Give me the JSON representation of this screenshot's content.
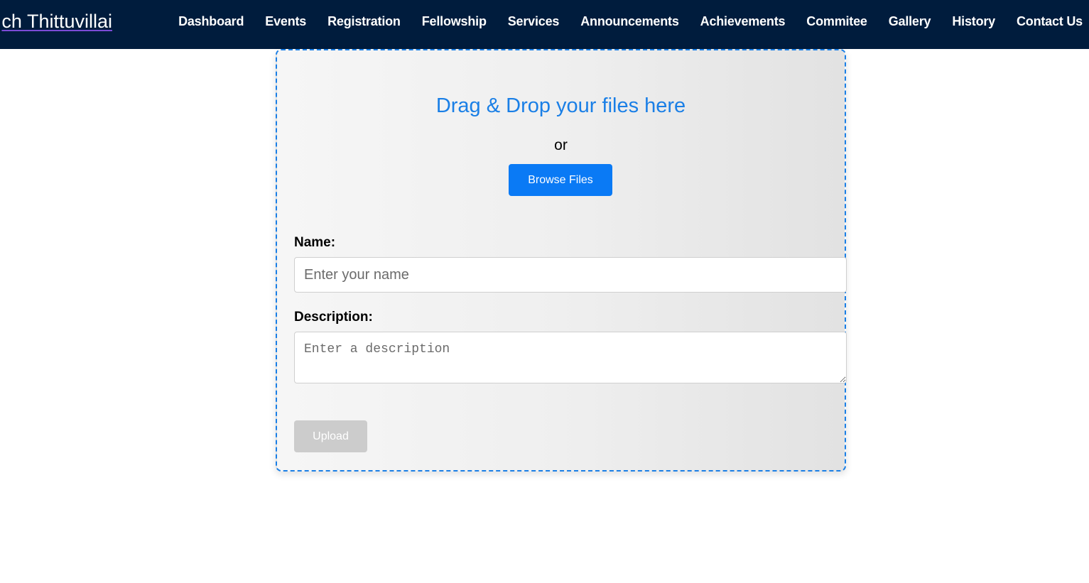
{
  "header": {
    "brand": "ch Thittuvillai",
    "nav": [
      {
        "label": "Dashboard"
      },
      {
        "label": "Events"
      },
      {
        "label": "Registration"
      },
      {
        "label": "Fellowship"
      },
      {
        "label": "Services"
      },
      {
        "label": "Announcements"
      },
      {
        "label": "Achievements"
      },
      {
        "label": "Commitee"
      },
      {
        "label": "Gallery"
      },
      {
        "label": "History"
      },
      {
        "label": "Contact Us"
      }
    ]
  },
  "upload": {
    "drop_title": "Drag & Drop your files here",
    "or_text": "or",
    "browse_label": "Browse Files",
    "name_label": "Name:",
    "name_value": "",
    "name_placeholder": "Enter your name",
    "description_label": "Description:",
    "description_value": "",
    "description_placeholder": "Enter a description",
    "upload_label": "Upload"
  },
  "colors": {
    "navbar_bg": "#001c3d",
    "accent_blue": "#0a7af5",
    "drop_border": "#1a7fe6",
    "disabled_button": "#cccccc"
  }
}
